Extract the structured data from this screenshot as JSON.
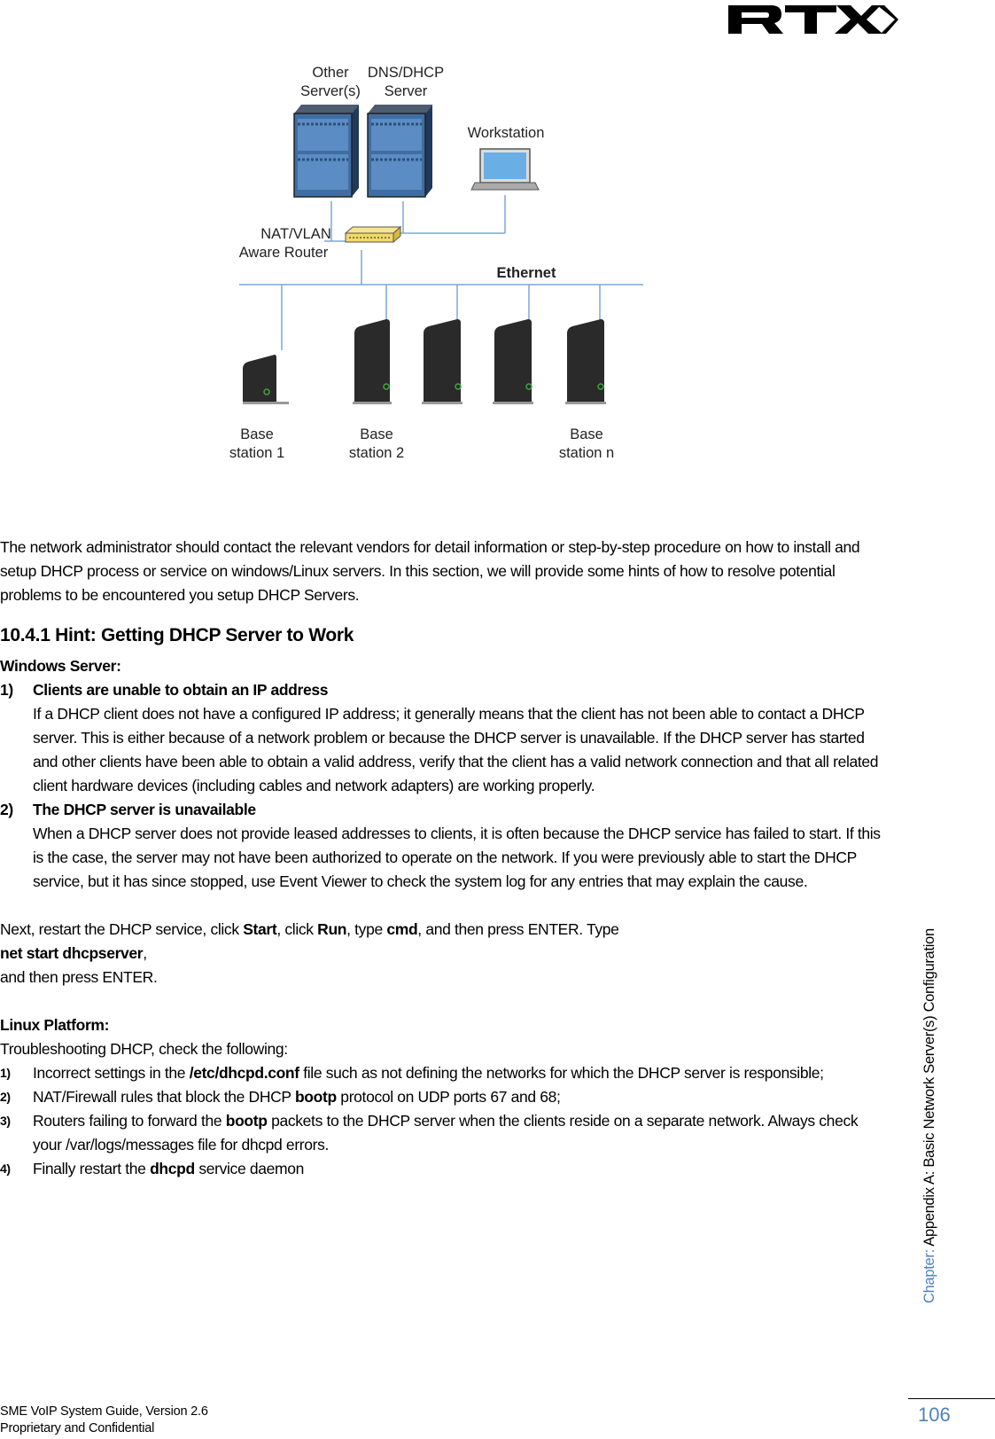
{
  "header": {
    "logo_text": "RTX"
  },
  "diagram": {
    "labels": {
      "other_servers_l1": "Other",
      "other_servers_l2": "Server(s)",
      "dns_dhcp_l1": "DNS/DHCP",
      "dns_dhcp_l2": "Server",
      "workstation": "Workstation",
      "router_l1": "NAT/VLAN",
      "router_l2": "Aware Router",
      "ethernet": "Ethernet",
      "base1_l1": "Base",
      "base1_l2": "station 1",
      "base2_l1": "Base",
      "base2_l2": "station 2",
      "basen_l1": "Base",
      "basen_l2": "station n"
    },
    "colors": {
      "line": "#7ea6d8",
      "server": "#3f6ea3",
      "router": "#f4d86a",
      "base": "#2a2a2a",
      "led": "#3ea83e"
    }
  },
  "intro": "The network administrator should contact the relevant vendors for detail information or step-by-step procedure on how to install and setup DHCP process or service on windows/Linux servers. In this section, we will provide some hints of how to resolve potential problems to be encountered you setup DHCP Servers.",
  "section": {
    "heading": "10.4.1 Hint: Getting DHCP Server to Work",
    "windows": {
      "title": "Windows Server:",
      "items": [
        {
          "num": "1)",
          "title": "Clients are unable to obtain an IP address",
          "body": "If a DHCP client does not have a configured IP address; it generally means that the client has not been able to contact a DHCP server. This is either because of a network problem or because the DHCP server is unavailable. If the DHCP server has started and other clients have been able to obtain a valid address, verify that the client has a valid network connection and that all related client hardware devices (including cables and network adapters) are working properly."
        },
        {
          "num": "2)",
          "title": "The DHCP server is unavailable",
          "body": "When a DHCP server does not provide leased addresses to clients, it is often because the DHCP service has failed to start. If this is the case, the server may not have been authorized to operate on the network. If you were previously able to start the DHCP service, but it has since stopped, use Event Viewer to check the system log for any entries that may explain the cause."
        }
      ],
      "restart": {
        "t1": "Next, restart the DHCP service, click ",
        "b1": "Start",
        "t2": ", click ",
        "b2": "Run",
        "t3": ", type ",
        "b3": "cmd",
        "t4": ", and then press ENTER. Type",
        "command": "net start dhcpserver",
        "t5": ",",
        "t6": "and then press ENTER."
      }
    },
    "linux": {
      "title": "Linux Platform:",
      "intro": "Troubleshooting DHCP, check the following:",
      "items": [
        {
          "num": "1)",
          "pre": "Incorrect settings in the ",
          "bold": "/etc/dhcpd.conf",
          "post": " file such as not defining the networks for which the DHCP server is responsible;"
        },
        {
          "num": "2)",
          "pre": "NAT/Firewall rules that block the DHCP ",
          "bold": "bootp",
          "post": " protocol on UDP ports 67 and 68;"
        },
        {
          "num": "3)",
          "pre": "Routers failing to forward the ",
          "bold": "bootp",
          "post": " packets to the DHCP server when the clients reside on a separate network. Always check your /var/logs/messages file for dhcpd errors."
        },
        {
          "num": "4)",
          "pre": "Finally restart the ",
          "bold": "dhcpd",
          "post": " service daemon"
        }
      ]
    }
  },
  "sidebar": {
    "chapter_label": "Chapter: ",
    "chapter_title": "Appendix A: Basic Network Server(s) Configuration"
  },
  "footer": {
    "line1": "SME VoIP System Guide, Version 2.6",
    "line2": "Proprietary and Confidential",
    "page_number": "106"
  }
}
